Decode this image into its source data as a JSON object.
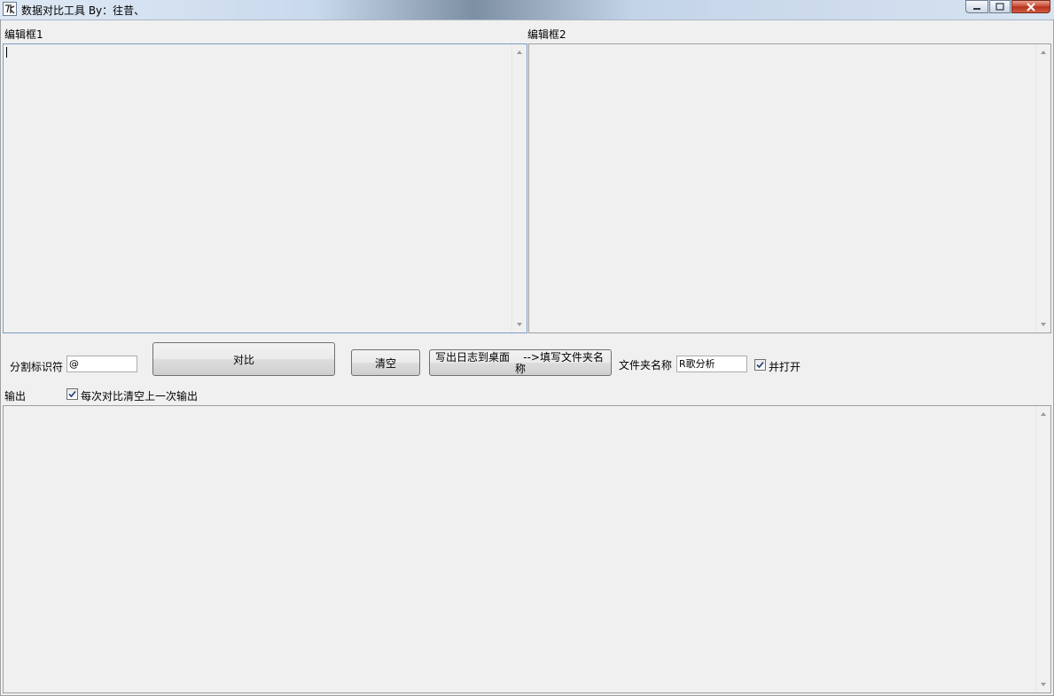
{
  "window": {
    "title": "数据对比工具  By：往昔、",
    "minimize_icon": "minimize-icon",
    "maximize_icon": "maximize-icon",
    "close_icon": "close-icon"
  },
  "editor1": {
    "label": "编辑框1",
    "value": ""
  },
  "editor2": {
    "label": "编辑框2",
    "value": ""
  },
  "controls": {
    "separator_label": "分割标识符",
    "separator_value": "@",
    "compare_button": "对比",
    "clear_button": "清空",
    "write_log_line1": "写出日志到桌面    -->填写文件夹名",
    "write_log_line2": "称",
    "folder_name_label": "文件夹名称",
    "folder_name_value": "R歌分析",
    "open_checkbox_label": "并打开",
    "open_checked": true
  },
  "output": {
    "label": "输出",
    "clear_each_time_label": "每次对比清空上一次输出",
    "clear_each_time_checked": true,
    "value": ""
  }
}
